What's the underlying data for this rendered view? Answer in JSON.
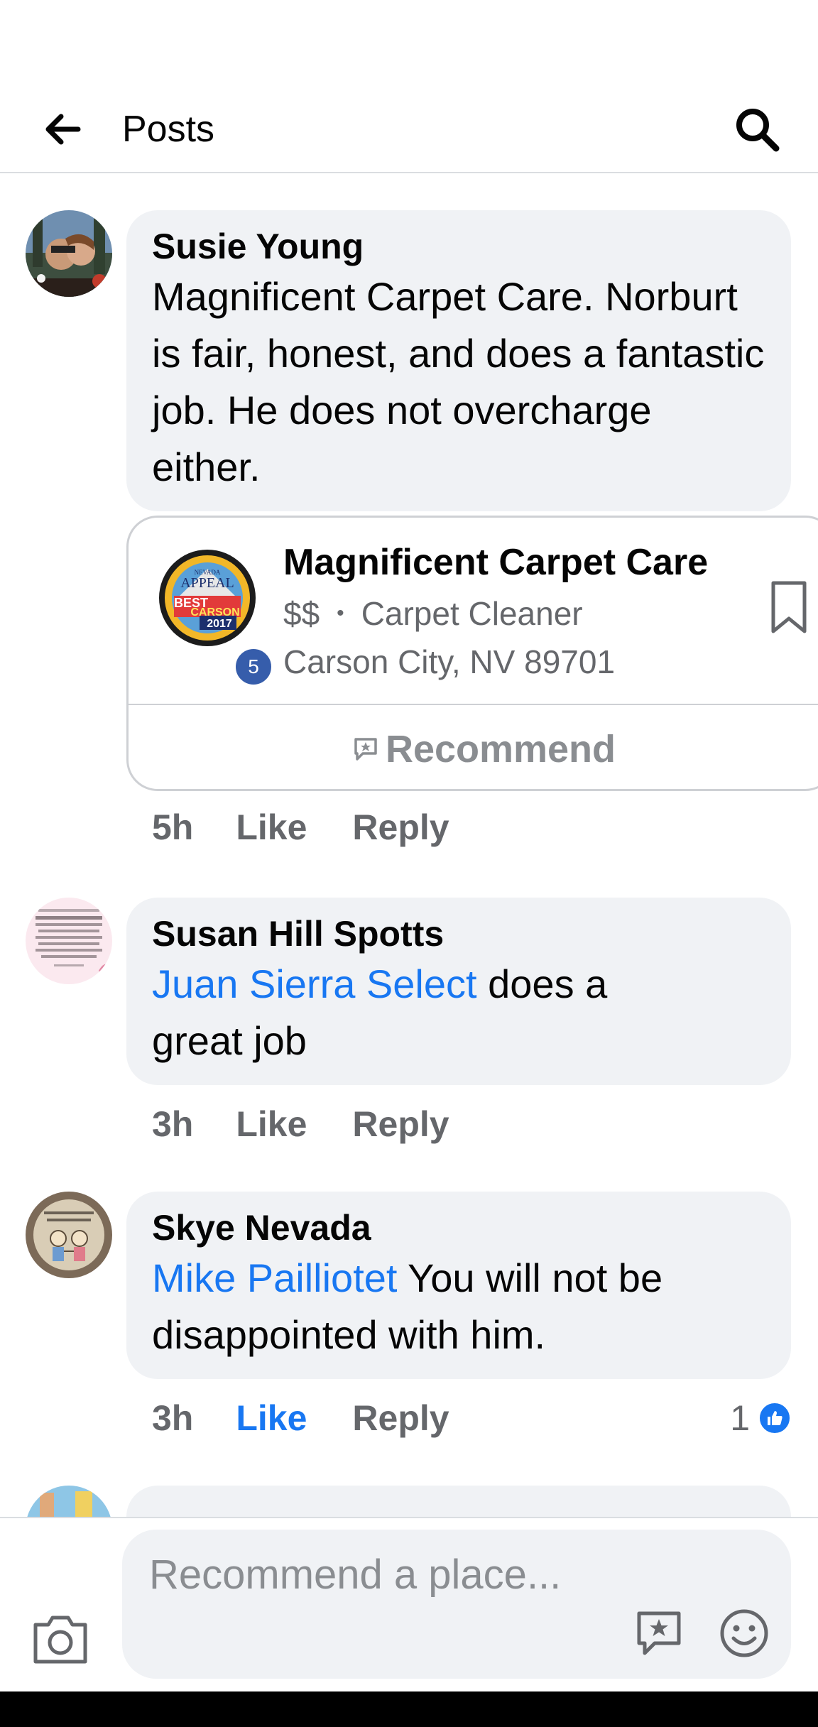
{
  "header": {
    "title": "Posts"
  },
  "comments": [
    {
      "author": "Susie Young",
      "text": "Magnificent Carpet Care. Norburt is fair, honest, and does a fantastic job.  He does not overcharge either.",
      "time": "5h",
      "like_label": "Like",
      "reply_label": "Reply",
      "place": {
        "name": "Magnificent Carpet Care",
        "price": "$$",
        "category": "Carpet Cleaner",
        "location": "Carson City, NV 89701",
        "rank": "5",
        "logo_text": [
          "NEVADA",
          "APPEAL",
          "BEST",
          "CARSON",
          "2017"
        ],
        "recommend_label": "Recommend"
      }
    },
    {
      "author": "Susan Hill Spotts",
      "mention": "Juan Sierra Select",
      "text_line1_rest": " does a",
      "text_line2": "great job",
      "time": "3h",
      "like_label": "Like",
      "reply_label": "Reply"
    },
    {
      "author": "Skye Nevada",
      "mention": "Mike Pailliotet",
      "text_line1_rest": " You will not be",
      "text_line2": "disappointed with him.",
      "time": "3h",
      "like_label": "Like",
      "reply_label": "Reply",
      "reaction_count": "1"
    }
  ],
  "composer": {
    "placeholder": "Recommend a place..."
  },
  "colors": {
    "accent": "#1877f2",
    "bubble": "#f0f2f5",
    "muted": "#65676b"
  },
  "icons": [
    "back-arrow-icon",
    "search-icon",
    "bookmark-icon",
    "recommend-icon",
    "like-icon",
    "camera-icon",
    "emoji-icon"
  ]
}
